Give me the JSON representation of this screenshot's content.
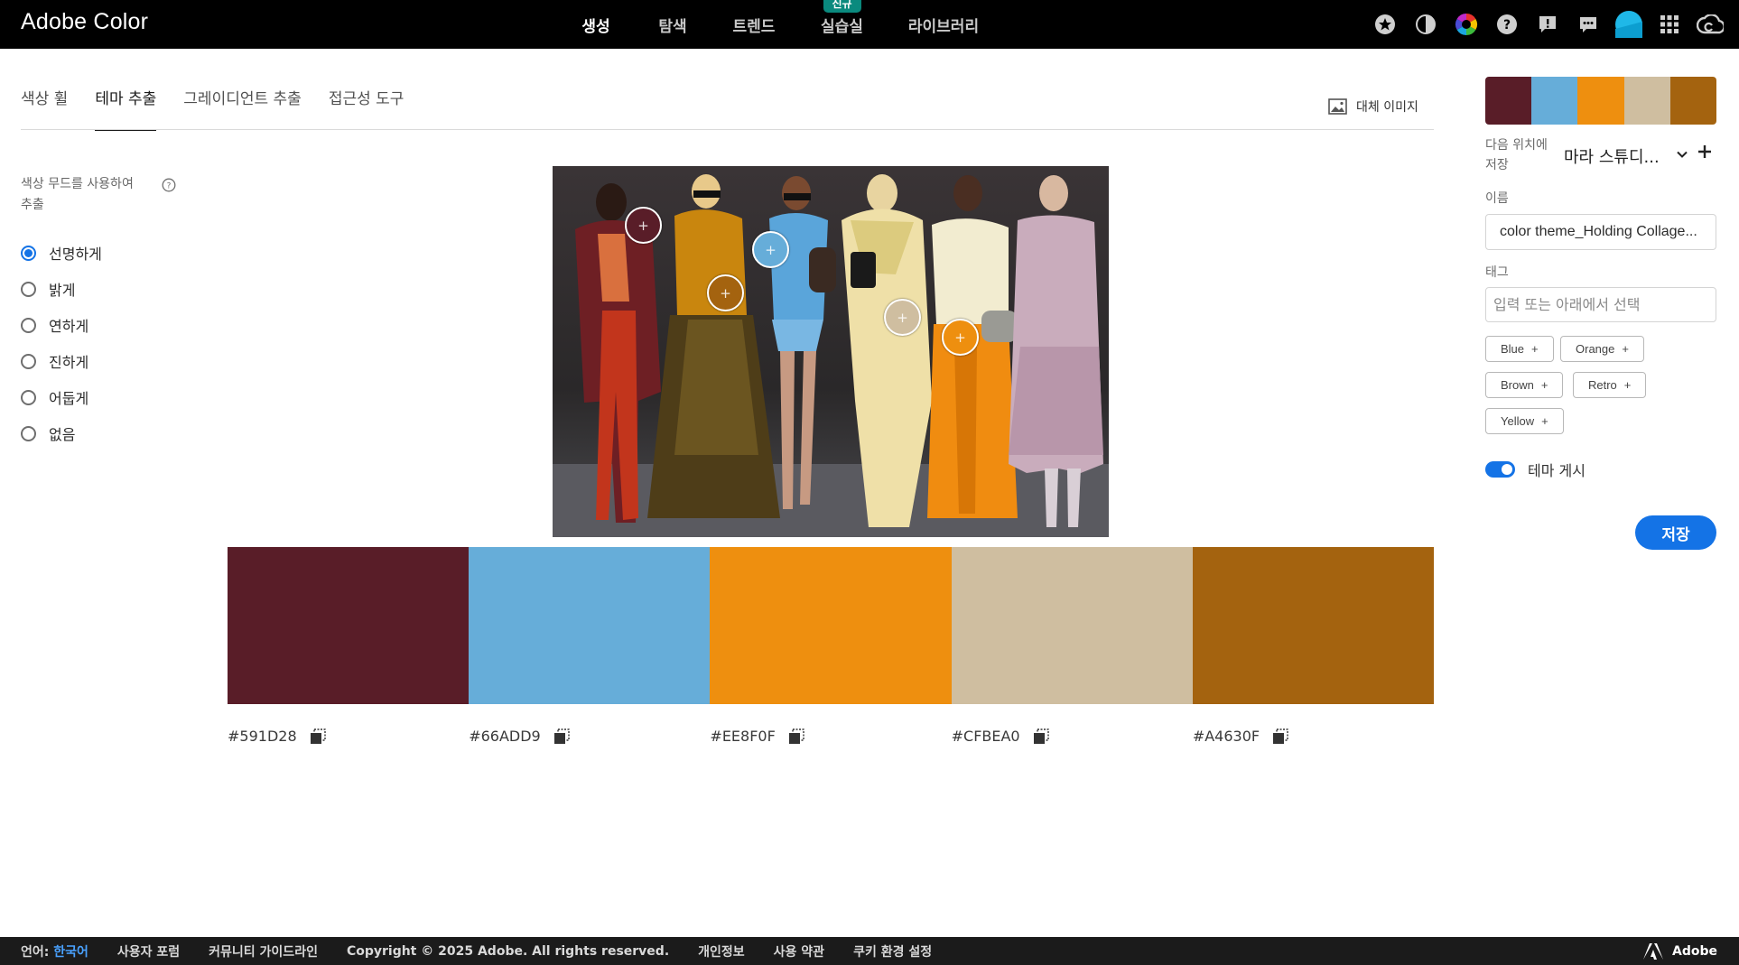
{
  "app": {
    "title": "Adobe Color"
  },
  "topnav": {
    "items": [
      {
        "label": "생성",
        "active": true
      },
      {
        "label": "탐색"
      },
      {
        "label": "트렌드"
      },
      {
        "label": "실습실",
        "badge": "신규"
      },
      {
        "label": "라이브러리"
      }
    ],
    "icons": [
      "favorites-icon",
      "contrast-icon",
      "color-wheel-icon",
      "help-icon",
      "feedback-icon",
      "chat-icon",
      "avatar",
      "apps-grid-icon",
      "creative-cloud-icon"
    ]
  },
  "tabs": [
    {
      "label": "색상 휠"
    },
    {
      "label": "테마 추출",
      "active": true
    },
    {
      "label": "그레이디언트 추출"
    },
    {
      "label": "접근성 도구"
    }
  ],
  "alt_image": {
    "label": "대체 이미지"
  },
  "mood": {
    "title": "색상 무드를 사용하여 추출",
    "options": [
      "선명하게",
      "밝게",
      "연하게",
      "진하게",
      "어둡게",
      "없음"
    ],
    "selected": "선명하게"
  },
  "palette": {
    "colors": [
      {
        "hex": "#591D28"
      },
      {
        "hex": "#66ADD9"
      },
      {
        "hex": "#EE8F0F"
      },
      {
        "hex": "#CFBEA0"
      },
      {
        "hex": "#A4630F"
      }
    ]
  },
  "right_panel": {
    "save_to_label": "다음 위치에 저장",
    "library": "마라 스튜디...",
    "name_label": "이름",
    "name_value": "color theme_Holding Collage...",
    "tag_label": "태그",
    "tag_placeholder": "입력 또는 아래에서 선택",
    "tags": [
      "Blue",
      "Orange",
      "Brown",
      "Retro",
      "Yellow"
    ],
    "publish_label": "테마 게시",
    "publish_on": true,
    "save_label": "저장"
  },
  "footer": {
    "language_label": "언어:",
    "language_value": "한국어",
    "links": [
      "사용자 포럼",
      "커뮤니티 가이드라인",
      "Copyright © 2025 Adobe. All rights reserved.",
      "개인정보",
      "사용 약관",
      "쿠키 환경 설정"
    ],
    "brand": "Adobe"
  }
}
